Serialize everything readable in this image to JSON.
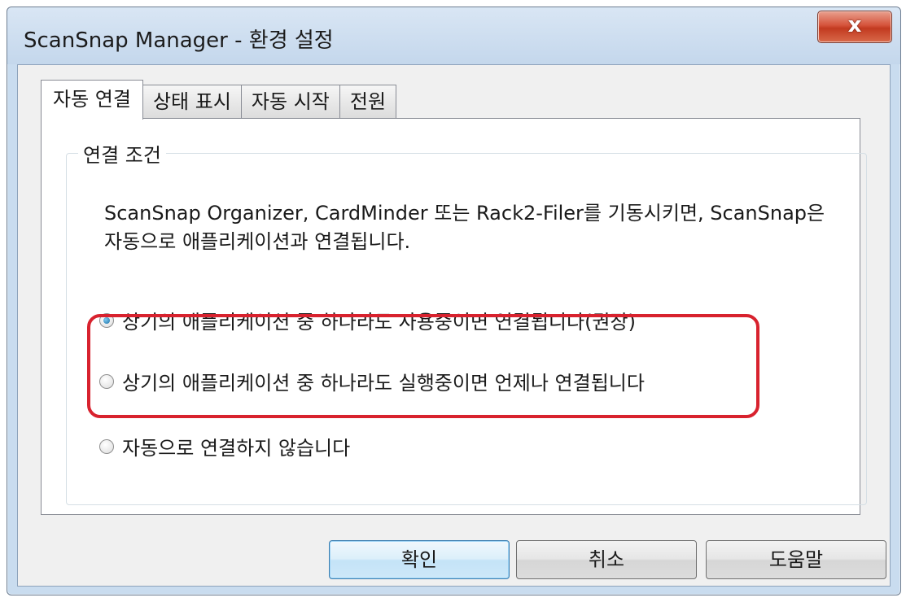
{
  "window": {
    "title": "ScanSnap Manager - 환경 설정",
    "close_label": "x"
  },
  "tabs": [
    {
      "label": "자동 연결",
      "active": true
    },
    {
      "label": "상태 표시",
      "active": false
    },
    {
      "label": "자동 시작",
      "active": false
    },
    {
      "label": "전원",
      "active": false
    }
  ],
  "group": {
    "title": "연결 조건",
    "description_line1": "ScanSnap Organizer, CardMinder 또는 Rack2-Filer를 기동시키면, ScanSnap은",
    "description_line2": "자동으로 애플리케이션과 연결됩니다."
  },
  "options": [
    {
      "label": "상기의 애플리케이션 중 하나라도 사용중이면 연결됩니다(권장)",
      "checked": true
    },
    {
      "label": "상기의 애플리케이션 중 하나라도 실행중이면 언제나 연결됩니다",
      "checked": false
    },
    {
      "label": "자동으로 연결하지 않습니다",
      "checked": false
    }
  ],
  "buttons": {
    "ok": "확인",
    "cancel": "취소",
    "help": "도움말"
  },
  "colors": {
    "highlight": "#d8222e",
    "title_bar": "#c9dcef",
    "close_button": "#c23a20"
  }
}
